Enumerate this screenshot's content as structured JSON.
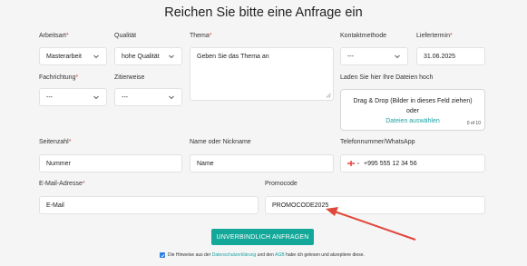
{
  "form": {
    "title": "Reichen Sie bitte eine Anfrage ein",
    "required_mark": "*",
    "arbeitsart": {
      "label": "Arbeitsart",
      "value": "Masterarbeit"
    },
    "qualitaet": {
      "label": "Qualität",
      "value": "hohe Qualität"
    },
    "thema": {
      "label": "Thema",
      "value": "Geben Sie das Thema an"
    },
    "kontaktmethode": {
      "label": "Kontaktmethode",
      "value": "---"
    },
    "liefertermin": {
      "label": "Liefertermin",
      "value": "31.06.2025"
    },
    "fachrichtung": {
      "label": "Fachrichtung",
      "value": "---"
    },
    "zitierweise": {
      "label": "Zitierweise",
      "value": "---"
    },
    "upload": {
      "label": "Laden Sie hier Ihre Dateien hoch",
      "line1": "Drag & Drop (Bilder in dieses Feld ziehen)",
      "line2": "oder",
      "link": "Dateien auswählen",
      "count": "0 of 10"
    },
    "seitenzahl": {
      "label": "Seitenzahl",
      "placeholder": "Nummer"
    },
    "name": {
      "label": "Name oder Nickname",
      "placeholder": "Name"
    },
    "telefon": {
      "label": "Telefonnummer/WhatsApp",
      "flag_icon": "georgia-flag-icon",
      "value": "+995 555 12 34 56"
    },
    "email": {
      "label": "E-Mail-Adresse",
      "placeholder": "E-Mail"
    },
    "promocode": {
      "label": "Promocode",
      "value": "PROMOCODE2025"
    },
    "submit_label": "UNVERBINDLICH ANFRAGEN",
    "consent": {
      "text_before": "Die Hinweise aus der",
      "link1": "Datenschutzerklärung",
      "text_middle": "und den",
      "link2": "AGB",
      "text_after": "habe ich gelesen und akzeptiere diese."
    }
  },
  "colors": {
    "accent": "#14a89a",
    "required": "#e53935",
    "arrow": "#e0473a"
  }
}
